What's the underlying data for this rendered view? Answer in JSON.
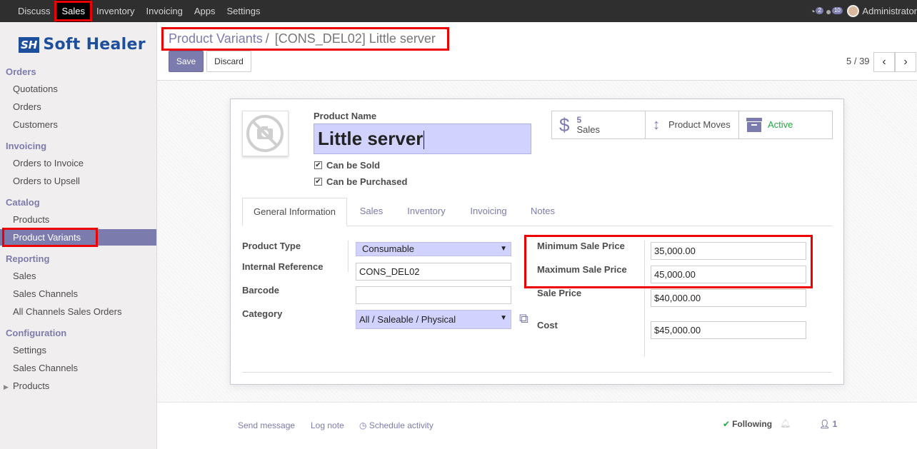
{
  "topbar": {
    "menu": [
      "Discuss",
      "Sales",
      "Inventory",
      "Invoicing",
      "Apps",
      "Settings"
    ],
    "active_menu": "Sales",
    "activity_count": "2",
    "message_count": "10",
    "user": "Administrator"
  },
  "logo": {
    "mark": "SH",
    "text": "Soft Healer"
  },
  "sidebar": {
    "orders": {
      "title": "Orders",
      "items": [
        "Quotations",
        "Orders",
        "Customers"
      ]
    },
    "invoicing": {
      "title": "Invoicing",
      "items": [
        "Orders to Invoice",
        "Orders to Upsell"
      ]
    },
    "catalog": {
      "title": "Catalog",
      "items": [
        "Products",
        "Product Variants"
      ]
    },
    "reporting": {
      "title": "Reporting",
      "items": [
        "Sales",
        "Sales Channels",
        "All Channels Sales Orders"
      ]
    },
    "configuration": {
      "title": "Configuration",
      "items": [
        "Settings",
        "Sales Channels",
        "Products"
      ]
    }
  },
  "breadcrumb": {
    "parent": "Product Variants",
    "separator": "/",
    "current": "[CONS_DEL02] Little server"
  },
  "buttons": {
    "save": "Save",
    "discard": "Discard"
  },
  "pager": {
    "value": "5 / 39",
    "prev": "‹",
    "next": "›"
  },
  "product": {
    "name_label": "Product Name",
    "name": "Little server",
    "can_be_sold": "Can be Sold",
    "can_be_purchased": "Can be Purchased"
  },
  "smart_buttons": {
    "sales_count": "5",
    "sales_label": "Sales",
    "moves_label": "Product Moves",
    "active_label": "Active"
  },
  "tabs": [
    "General Information",
    "Sales",
    "Inventory",
    "Invoicing",
    "Notes"
  ],
  "fields": {
    "product_type": {
      "label": "Product Type",
      "value": "Consumable"
    },
    "internal_reference": {
      "label": "Internal Reference",
      "value": "CONS_DEL02"
    },
    "barcode": {
      "label": "Barcode",
      "value": ""
    },
    "category": {
      "label": "Category",
      "value": "All / Saleable / Physical"
    },
    "min_sale_price": {
      "label": "Minimum Sale Price",
      "value": "35,000.00"
    },
    "max_sale_price": {
      "label": "Maximum Sale Price",
      "value": "45,000.00"
    },
    "sale_price": {
      "label": "Sale Price",
      "value": "$40,000.00"
    },
    "cost": {
      "label": "Cost",
      "value": "$45,000.00"
    }
  },
  "chatter": {
    "send_message": "Send message",
    "log_note": "Log note",
    "schedule_activity": "Schedule activity",
    "following": "Following",
    "followers_count": "1"
  },
  "colors": {
    "accent": "#7c7bad",
    "highlight_box": "#ee0000",
    "topbar": "#2f2f2f"
  }
}
